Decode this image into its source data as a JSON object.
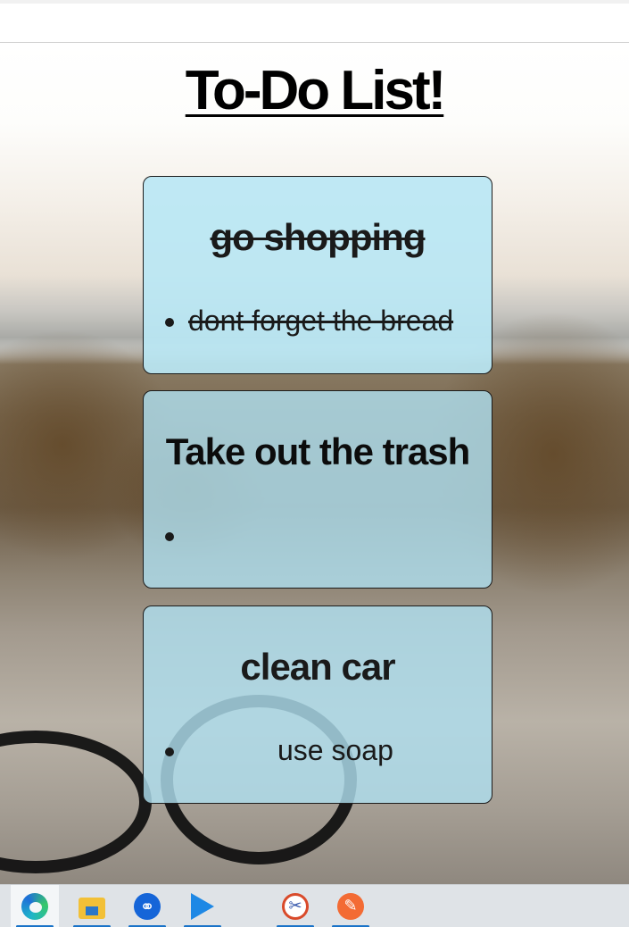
{
  "page": {
    "title": "To-Do List!"
  },
  "todos": [
    {
      "title": "go shopping",
      "completed": true,
      "items": [
        "dont forget the bread"
      ]
    },
    {
      "title": "Take out the trash",
      "completed": false,
      "items": [
        ""
      ]
    },
    {
      "title": "clean car",
      "completed": false,
      "items": [
        "use soap"
      ]
    }
  ],
  "taskbar": {
    "apps": [
      {
        "name": "Microsoft Edge",
        "icon": "edge-icon",
        "active": true
      },
      {
        "name": "File Explorer",
        "icon": "folder-icon",
        "active": false
      },
      {
        "name": "Bluetooth app",
        "icon": "bluetooth-app-icon",
        "active": false
      },
      {
        "name": "Visual Studio Code",
        "icon": "vscode-icon",
        "active": false
      },
      {
        "name": "Snipping Tool",
        "icon": "snipping-tool-icon",
        "active": false
      },
      {
        "name": "Pen app",
        "icon": "pen-icon",
        "active": false
      }
    ]
  },
  "colors": {
    "card_background": "#afdeee",
    "card_border": "#1c1c1c",
    "taskbar_accent": "#1a73c8"
  }
}
